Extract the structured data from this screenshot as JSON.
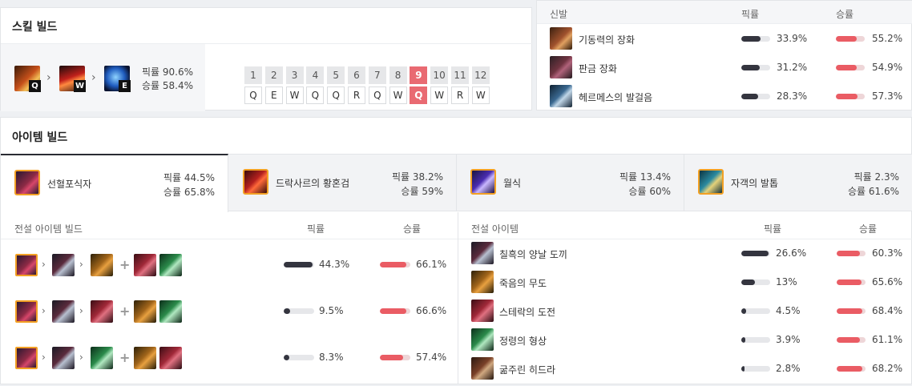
{
  "skills": {
    "title": "스킬 빌드",
    "order_keys": [
      "Q",
      "W",
      "E"
    ],
    "pick_label": "픽률 90.6%",
    "win_label": "승률 58.4%",
    "levels": [
      "1",
      "2",
      "3",
      "4",
      "5",
      "6",
      "7",
      "8",
      "9",
      "10",
      "11",
      "12"
    ],
    "sequence": [
      "Q",
      "E",
      "W",
      "Q",
      "Q",
      "R",
      "Q",
      "W",
      "Q",
      "W",
      "R",
      "W"
    ],
    "highlight_level": "9"
  },
  "boots": {
    "header": {
      "name": "신발",
      "pick": "픽률",
      "win": "승률"
    },
    "rows": [
      {
        "name": "기동력의 장화",
        "pick": "33.9%",
        "pick_frac": 0.68,
        "win": "55.2%",
        "win_frac": 0.72
      },
      {
        "name": "판금 장화",
        "pick": "31.2%",
        "pick_frac": 0.64,
        "win": "54.9%",
        "win_frac": 0.72
      },
      {
        "name": "헤르메스의 발걸음",
        "pick": "28.3%",
        "pick_frac": 0.58,
        "win": "57.3%",
        "win_frac": 0.75
      }
    ]
  },
  "items": {
    "title": "아이템 빌드",
    "tabs": [
      {
        "name": "선혈포식자",
        "pick": "픽률 44.5%",
        "win": "승률 65.8%"
      },
      {
        "name": "드락사르의 황혼검",
        "pick": "픽률 38.2%",
        "win": "승률 59%"
      },
      {
        "name": "월식",
        "pick": "픽률 13.4%",
        "win": "승률 60%"
      },
      {
        "name": "자객의 발톱",
        "pick": "픽률 2.3%",
        "win": "승률 61.6%"
      }
    ],
    "builds_header": {
      "name": "전설 아이템 빌드",
      "pick": "픽률",
      "win": "승률"
    },
    "builds": [
      {
        "pick": "44.3%",
        "pick_frac": 0.95,
        "win": "66.1%",
        "win_frac": 0.86
      },
      {
        "pick": "9.5%",
        "pick_frac": 0.2,
        "win": "66.6%",
        "win_frac": 0.86
      },
      {
        "pick": "8.3%",
        "pick_frac": 0.18,
        "win": "57.4%",
        "win_frac": 0.77
      }
    ],
    "legend_header": {
      "name": "전설 아이템",
      "pick": "픽률",
      "win": "승률"
    },
    "legend": [
      {
        "name": "칠흑의 양날 도끼",
        "pick": "26.6%",
        "pick_frac": 0.95,
        "win": "60.3%",
        "win_frac": 0.8
      },
      {
        "name": "죽음의 무도",
        "pick": "13%",
        "pick_frac": 0.47,
        "win": "65.6%",
        "win_frac": 0.86
      },
      {
        "name": "스테락의 도전",
        "pick": "4.5%",
        "pick_frac": 0.17,
        "win": "68.4%",
        "win_frac": 0.9
      },
      {
        "name": "정령의 형상",
        "pick": "3.9%",
        "pick_frac": 0.15,
        "win": "61.1%",
        "win_frac": 0.8
      },
      {
        "name": "굶주린 히드라",
        "pick": "2.8%",
        "pick_frac": 0.1,
        "win": "68.2%",
        "win_frac": 0.9
      }
    ]
  },
  "colors": {
    "pick_bar": "#34353f",
    "win_bar": "#ea5c64",
    "highlight": "#e96a72",
    "mythic_border": "#f2a024"
  }
}
